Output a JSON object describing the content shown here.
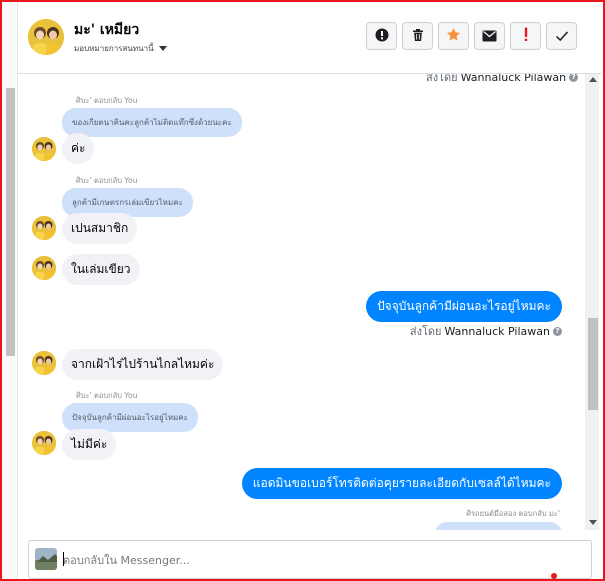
{
  "header": {
    "contact_name": "มะ' เหมียว",
    "assign_label": "มอบหมายการสนทนานี้",
    "toolbar": {
      "mark_spam": "exclamation-circle-icon",
      "delete": "trash-icon",
      "star": "star-icon",
      "mark_unread": "envelope-icon",
      "follow_up": "exclamation-icon",
      "mark_done": "check-icon"
    },
    "star_color": "#f7923a",
    "alert_color": "#e8171d"
  },
  "top_sent_by": {
    "prefix": "ส่งโดย",
    "name": "Wannaluck Pilawan"
  },
  "messages": [
    {
      "reply_label": "ศิบะ' ตอบกลับ You",
      "quote": "ของเกียตนาคินคะลูกค้าไม่ติดแท๊กซึ่งด้วยนะคะ",
      "text": "ค่ะ"
    },
    {
      "reply_label": "ศิบะ' ตอบกลับ You",
      "quote": "ลูกค้ามีเกษตรกรเล่มเขียวไหมคะ",
      "text": "เปนสมาชิก"
    },
    {
      "text": "ในเล่มเขียว"
    },
    {
      "outgoing": "ปัจจุบันลูกค้ามีผ่อนอะไรอยู่ไหมคะ"
    },
    {
      "sent_by_prefix": "ส่งโดย",
      "sent_by_name": "Wannaluck Pilawan"
    },
    {
      "text": "จากเฝ้าไร่ไปร้านไกลไหมค่ะ"
    },
    {
      "reply_label": "ศิบะ' ตอบกลับ You",
      "quote": "ปัจจุบันลูกค้ามีผ่อนอะไรอยู่ไหมคะ",
      "text": "ไม่มีค่ะ"
    },
    {
      "outgoing": "แอดมินขอเบอร์โทรติดต่อคุยรายละเอียดกับเซลล์ได้ไหมคะ"
    },
    {
      "reply_label": "ศิรถยนต์มือสอง ตอบกลับ มะ'"
    }
  ],
  "composer": {
    "placeholder": "ตอบกลับใน Messenger..."
  },
  "colors": {
    "outgoing_bubble": "#0084ff",
    "incoming_bubble": "#f0f2f5",
    "quote_bubble": "#cfe0fb",
    "frame": "#e8171d"
  }
}
